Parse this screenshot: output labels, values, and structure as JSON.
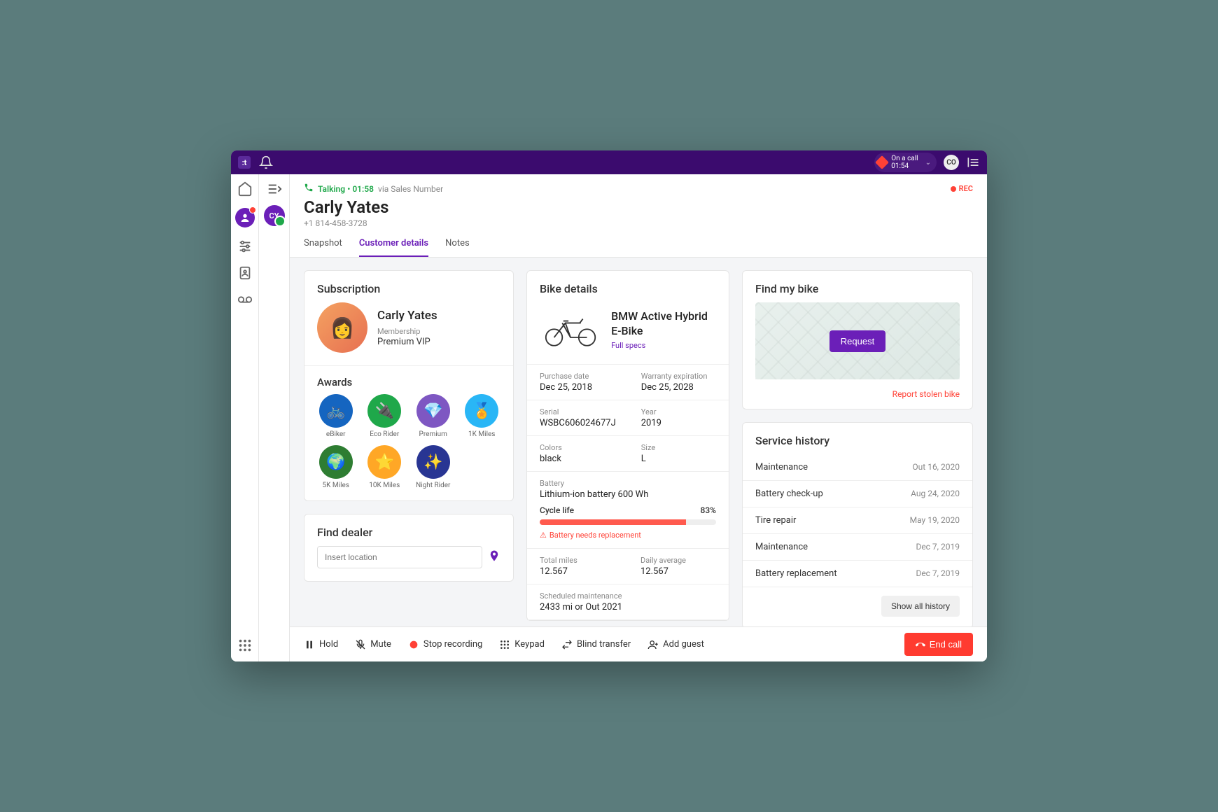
{
  "topbar": {
    "call_status_label": "On a call",
    "call_timer": "01:54",
    "user_initials": "CO"
  },
  "contact_chip": "CY",
  "header": {
    "status": "Talking",
    "timer": "01:58",
    "via": "via Sales Number",
    "rec": "REC",
    "name": "Carly Yates",
    "phone": "+1 814-458-3728"
  },
  "tabs": {
    "snapshot": "Snapshot",
    "customer_details": "Customer details",
    "notes": "Notes"
  },
  "subscription": {
    "title": "Subscription",
    "name": "Carly Yates",
    "membership_label": "Membership",
    "membership_value": "Premium VIP",
    "awards_title": "Awards",
    "awards": [
      {
        "label": "eBiker",
        "bg": "#1565c0",
        "emoji": "🚲"
      },
      {
        "label": "Eco Rider",
        "bg": "#1fa84a",
        "emoji": "🔌"
      },
      {
        "label": "Premium",
        "bg": "#7e57c2",
        "emoji": "💎"
      },
      {
        "label": "1K Miles",
        "bg": "#29b6f6",
        "emoji": "🏅"
      },
      {
        "label": "5K Miles",
        "bg": "#2e7d32",
        "emoji": "🌍"
      },
      {
        "label": "10K Miles",
        "bg": "#ffa726",
        "emoji": "⭐"
      },
      {
        "label": "Night Rider",
        "bg": "#283593",
        "emoji": "✨"
      }
    ]
  },
  "bike": {
    "title": "Bike details",
    "name": "BMW Active Hybrid E-Bike",
    "specs_link": "Full specs",
    "purchase_date_label": "Purchase date",
    "purchase_date": "Dec 25, 2018",
    "warranty_label": "Warranty expiration",
    "warranty": "Dec 25, 2028",
    "serial_label": "Serial",
    "serial": "WSBC606024677J",
    "year_label": "Year",
    "year": "2019",
    "colors_label": "Colors",
    "colors": "black",
    "size_label": "Size",
    "size": "L",
    "battery_label": "Battery",
    "battery": "Lithium-ion battery 600 Wh",
    "cycle_label": "Cycle life",
    "cycle_pct": "83%",
    "cycle_fill_pct": 83,
    "warn": "Battery needs replacement",
    "total_miles_label": "Total miles",
    "total_miles": "12.567",
    "daily_avg_label": "Daily average",
    "daily_avg": "12.567",
    "sched_label": "Scheduled maintenance",
    "sched": "2433 mi or Out 2021"
  },
  "find_bike": {
    "title": "Find my bike",
    "request": "Request",
    "stolen": "Report stolen bike"
  },
  "service": {
    "title": "Service history",
    "rows": [
      {
        "label": "Maintenance",
        "date": "Out 16, 2020"
      },
      {
        "label": "Battery check-up",
        "date": "Aug 24, 2020"
      },
      {
        "label": "Tire repair",
        "date": "May 19, 2020"
      },
      {
        "label": "Maintenance",
        "date": "Dec 7, 2019"
      },
      {
        "label": "Battery replacement",
        "date": "Dec 7, 2019"
      }
    ],
    "show_all": "Show all history"
  },
  "dealer": {
    "title": "Find dealer",
    "placeholder": "Insert location"
  },
  "callbar": {
    "hold": "Hold",
    "mute": "Mute",
    "stop_rec": "Stop recording",
    "keypad": "Keypad",
    "blind_transfer": "Blind transfer",
    "add_guest": "Add guest",
    "end_call": "End call"
  }
}
